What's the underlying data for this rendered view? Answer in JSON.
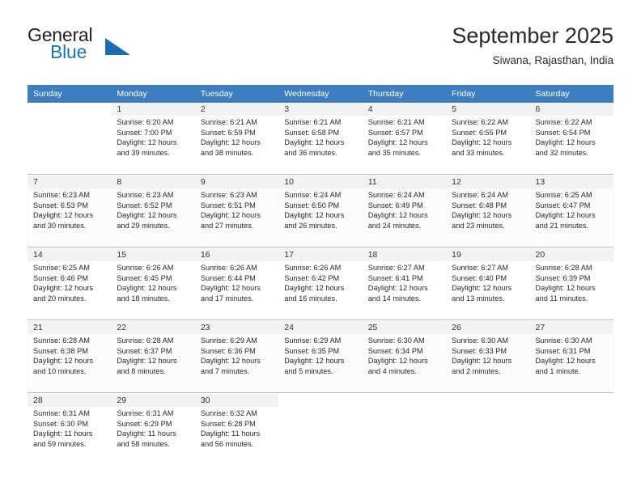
{
  "brand": {
    "name_part1": "General",
    "name_part2": "Blue",
    "triangle_icon": "brand-triangle-icon",
    "accent_color": "#1b75bb"
  },
  "header": {
    "title": "September 2025",
    "subtitle": "Siwana, Rajasthan, India"
  },
  "theme": {
    "header_row_bg": "#3c7ebf",
    "header_row_text": "#ffffff",
    "day_band_bg": "#f2f2f2",
    "grid_line": "#bcbcbc"
  },
  "weekdays": [
    "Sunday",
    "Monday",
    "Tuesday",
    "Wednesday",
    "Thursday",
    "Friday",
    "Saturday"
  ],
  "labels": {
    "sunrise_prefix": "Sunrise:",
    "sunset_prefix": "Sunset:",
    "daylight_prefix": "Daylight:"
  },
  "weeks": [
    [
      {
        "blank": true
      },
      {
        "day": "1",
        "sunrise": "Sunrise: 6:20 AM",
        "sunset": "Sunset: 7:00 PM",
        "daylight_line1": "Daylight: 12 hours",
        "daylight_line2": "and 39 minutes."
      },
      {
        "day": "2",
        "sunrise": "Sunrise: 6:21 AM",
        "sunset": "Sunset: 6:59 PM",
        "daylight_line1": "Daylight: 12 hours",
        "daylight_line2": "and 38 minutes."
      },
      {
        "day": "3",
        "sunrise": "Sunrise: 6:21 AM",
        "sunset": "Sunset: 6:58 PM",
        "daylight_line1": "Daylight: 12 hours",
        "daylight_line2": "and 36 minutes."
      },
      {
        "day": "4",
        "sunrise": "Sunrise: 6:21 AM",
        "sunset": "Sunset: 6:57 PM",
        "daylight_line1": "Daylight: 12 hours",
        "daylight_line2": "and 35 minutes."
      },
      {
        "day": "5",
        "sunrise": "Sunrise: 6:22 AM",
        "sunset": "Sunset: 6:55 PM",
        "daylight_line1": "Daylight: 12 hours",
        "daylight_line2": "and 33 minutes."
      },
      {
        "day": "6",
        "sunrise": "Sunrise: 6:22 AM",
        "sunset": "Sunset: 6:54 PM",
        "daylight_line1": "Daylight: 12 hours",
        "daylight_line2": "and 32 minutes."
      }
    ],
    [
      {
        "day": "7",
        "sunrise": "Sunrise: 6:23 AM",
        "sunset": "Sunset: 6:53 PM",
        "daylight_line1": "Daylight: 12 hours",
        "daylight_line2": "and 30 minutes."
      },
      {
        "day": "8",
        "sunrise": "Sunrise: 6:23 AM",
        "sunset": "Sunset: 6:52 PM",
        "daylight_line1": "Daylight: 12 hours",
        "daylight_line2": "and 29 minutes."
      },
      {
        "day": "9",
        "sunrise": "Sunrise: 6:23 AM",
        "sunset": "Sunset: 6:51 PM",
        "daylight_line1": "Daylight: 12 hours",
        "daylight_line2": "and 27 minutes."
      },
      {
        "day": "10",
        "sunrise": "Sunrise: 6:24 AM",
        "sunset": "Sunset: 6:50 PM",
        "daylight_line1": "Daylight: 12 hours",
        "daylight_line2": "and 26 minutes."
      },
      {
        "day": "11",
        "sunrise": "Sunrise: 6:24 AM",
        "sunset": "Sunset: 6:49 PM",
        "daylight_line1": "Daylight: 12 hours",
        "daylight_line2": "and 24 minutes."
      },
      {
        "day": "12",
        "sunrise": "Sunrise: 6:24 AM",
        "sunset": "Sunset: 6:48 PM",
        "daylight_line1": "Daylight: 12 hours",
        "daylight_line2": "and 23 minutes."
      },
      {
        "day": "13",
        "sunrise": "Sunrise: 6:25 AM",
        "sunset": "Sunset: 6:47 PM",
        "daylight_line1": "Daylight: 12 hours",
        "daylight_line2": "and 21 minutes."
      }
    ],
    [
      {
        "day": "14",
        "sunrise": "Sunrise: 6:25 AM",
        "sunset": "Sunset: 6:46 PM",
        "daylight_line1": "Daylight: 12 hours",
        "daylight_line2": "and 20 minutes."
      },
      {
        "day": "15",
        "sunrise": "Sunrise: 6:26 AM",
        "sunset": "Sunset: 6:45 PM",
        "daylight_line1": "Daylight: 12 hours",
        "daylight_line2": "and 18 minutes."
      },
      {
        "day": "16",
        "sunrise": "Sunrise: 6:26 AM",
        "sunset": "Sunset: 6:44 PM",
        "daylight_line1": "Daylight: 12 hours",
        "daylight_line2": "and 17 minutes."
      },
      {
        "day": "17",
        "sunrise": "Sunrise: 6:26 AM",
        "sunset": "Sunset: 6:42 PM",
        "daylight_line1": "Daylight: 12 hours",
        "daylight_line2": "and 16 minutes."
      },
      {
        "day": "18",
        "sunrise": "Sunrise: 6:27 AM",
        "sunset": "Sunset: 6:41 PM",
        "daylight_line1": "Daylight: 12 hours",
        "daylight_line2": "and 14 minutes."
      },
      {
        "day": "19",
        "sunrise": "Sunrise: 6:27 AM",
        "sunset": "Sunset: 6:40 PM",
        "daylight_line1": "Daylight: 12 hours",
        "daylight_line2": "and 13 minutes."
      },
      {
        "day": "20",
        "sunrise": "Sunrise: 6:28 AM",
        "sunset": "Sunset: 6:39 PM",
        "daylight_line1": "Daylight: 12 hours",
        "daylight_line2": "and 11 minutes."
      }
    ],
    [
      {
        "day": "21",
        "sunrise": "Sunrise: 6:28 AM",
        "sunset": "Sunset: 6:38 PM",
        "daylight_line1": "Daylight: 12 hours",
        "daylight_line2": "and 10 minutes."
      },
      {
        "day": "22",
        "sunrise": "Sunrise: 6:28 AM",
        "sunset": "Sunset: 6:37 PM",
        "daylight_line1": "Daylight: 12 hours",
        "daylight_line2": "and 8 minutes."
      },
      {
        "day": "23",
        "sunrise": "Sunrise: 6:29 AM",
        "sunset": "Sunset: 6:36 PM",
        "daylight_line1": "Daylight: 12 hours",
        "daylight_line2": "and 7 minutes."
      },
      {
        "day": "24",
        "sunrise": "Sunrise: 6:29 AM",
        "sunset": "Sunset: 6:35 PM",
        "daylight_line1": "Daylight: 12 hours",
        "daylight_line2": "and 5 minutes."
      },
      {
        "day": "25",
        "sunrise": "Sunrise: 6:30 AM",
        "sunset": "Sunset: 6:34 PM",
        "daylight_line1": "Daylight: 12 hours",
        "daylight_line2": "and 4 minutes."
      },
      {
        "day": "26",
        "sunrise": "Sunrise: 6:30 AM",
        "sunset": "Sunset: 6:33 PM",
        "daylight_line1": "Daylight: 12 hours",
        "daylight_line2": "and 2 minutes."
      },
      {
        "day": "27",
        "sunrise": "Sunrise: 6:30 AM",
        "sunset": "Sunset: 6:31 PM",
        "daylight_line1": "Daylight: 12 hours",
        "daylight_line2": "and 1 minute."
      }
    ],
    [
      {
        "day": "28",
        "sunrise": "Sunrise: 6:31 AM",
        "sunset": "Sunset: 6:30 PM",
        "daylight_line1": "Daylight: 11 hours",
        "daylight_line2": "and 59 minutes."
      },
      {
        "day": "29",
        "sunrise": "Sunrise: 6:31 AM",
        "sunset": "Sunset: 6:29 PM",
        "daylight_line1": "Daylight: 11 hours",
        "daylight_line2": "and 58 minutes."
      },
      {
        "day": "30",
        "sunrise": "Sunrise: 6:32 AM",
        "sunset": "Sunset: 6:28 PM",
        "daylight_line1": "Daylight: 11 hours",
        "daylight_line2": "and 56 minutes."
      },
      {
        "blank": true
      },
      {
        "blank": true
      },
      {
        "blank": true
      },
      {
        "blank": true
      }
    ]
  ]
}
